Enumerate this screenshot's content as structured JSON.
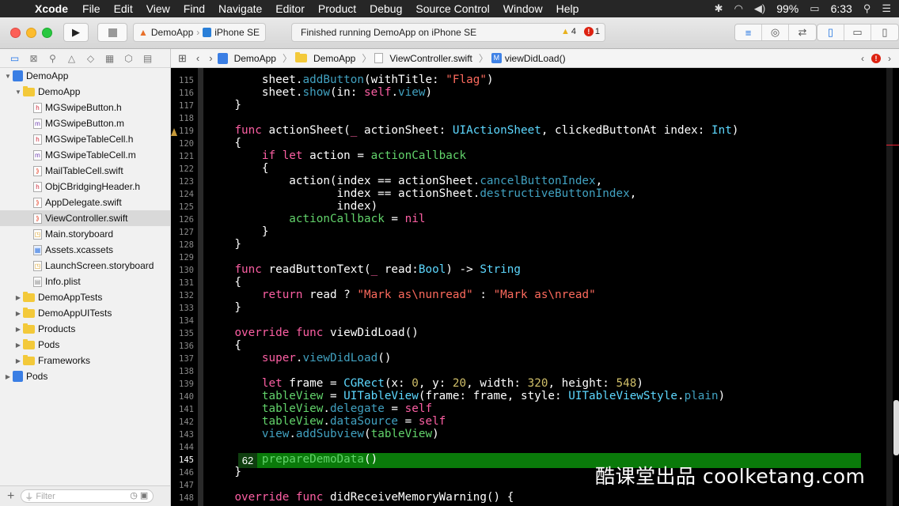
{
  "menubar": {
    "app": "Xcode",
    "items": [
      "File",
      "Edit",
      "View",
      "Find",
      "Navigate",
      "Editor",
      "Product",
      "Debug",
      "Source Control",
      "Window",
      "Help"
    ],
    "battery": "99%",
    "clock": "6:33"
  },
  "toolbar": {
    "scheme": "DemoApp",
    "destination": "iPhone SE",
    "activity": "Finished running DemoApp on iPhone SE",
    "warnings": "4",
    "errors": "1"
  },
  "navigator": {
    "filter_placeholder": "Filter",
    "items": [
      {
        "label": "DemoApp",
        "kind": "project",
        "depth": 0,
        "open": true
      },
      {
        "label": "DemoApp",
        "kind": "folder",
        "depth": 1,
        "open": true
      },
      {
        "label": "MGSwipeButton.h",
        "kind": "h",
        "depth": 2
      },
      {
        "label": "MGSwipeButton.m",
        "kind": "m",
        "depth": 2
      },
      {
        "label": "MGSwipeTableCell.h",
        "kind": "h",
        "depth": 2
      },
      {
        "label": "MGSwipeTableCell.m",
        "kind": "m",
        "depth": 2
      },
      {
        "label": "MailTableCell.swift",
        "kind": "swift",
        "depth": 2
      },
      {
        "label": "ObjCBridgingHeader.h",
        "kind": "h",
        "depth": 2
      },
      {
        "label": "AppDelegate.swift",
        "kind": "swift",
        "depth": 2
      },
      {
        "label": "ViewController.swift",
        "kind": "swift",
        "depth": 2,
        "selected": true
      },
      {
        "label": "Main.storyboard",
        "kind": "sb",
        "depth": 2
      },
      {
        "label": "Assets.xcassets",
        "kind": "assets",
        "depth": 2
      },
      {
        "label": "LaunchScreen.storyboard",
        "kind": "sb",
        "depth": 2
      },
      {
        "label": "Info.plist",
        "kind": "plist",
        "depth": 2
      },
      {
        "label": "DemoAppTests",
        "kind": "folder",
        "depth": 1,
        "open": false
      },
      {
        "label": "DemoAppUITests",
        "kind": "folder",
        "depth": 1,
        "open": false
      },
      {
        "label": "Products",
        "kind": "folder",
        "depth": 1,
        "open": false
      },
      {
        "label": "Pods",
        "kind": "folder",
        "depth": 1,
        "open": false
      },
      {
        "label": "Frameworks",
        "kind": "folder",
        "depth": 1,
        "open": false
      },
      {
        "label": "Pods",
        "kind": "project",
        "depth": 0,
        "open": false
      }
    ]
  },
  "jumpbar": {
    "crumbs": [
      "DemoApp",
      "DemoApp",
      "ViewController.swift",
      "viewDidLoad()"
    ]
  },
  "editor": {
    "current_line": 145,
    "exec_badge": "62",
    "first_line": 115,
    "line_numbers": [
      "115",
      "116",
      "117",
      "118",
      "119",
      "120",
      "121",
      "122",
      "123",
      "124",
      "125",
      "126",
      "127",
      "128",
      "129",
      "130",
      "131",
      "132",
      "133",
      "134",
      "135",
      "136",
      "137",
      "138",
      "139",
      "140",
      "141",
      "142",
      "143",
      "144",
      "145",
      "146",
      "147",
      "148"
    ],
    "lines": [
      [
        [
          "        sheet.",
          ""
        ],
        [
          "addButton",
          "fn"
        ],
        [
          "(withTitle: ",
          ""
        ],
        [
          "\"Flag\"",
          "st"
        ],
        [
          ")",
          ""
        ]
      ],
      [
        [
          "        sheet.",
          ""
        ],
        [
          "show",
          "fn"
        ],
        [
          "(in: ",
          ""
        ],
        [
          "self",
          "kw"
        ],
        [
          ".",
          ""
        ],
        [
          "view",
          "fn"
        ],
        [
          ")",
          ""
        ]
      ],
      [
        [
          "    }",
          ""
        ]
      ],
      [
        [
          "",
          ""
        ]
      ],
      [
        [
          "    ",
          ""
        ],
        [
          "func",
          "kw"
        ],
        [
          " actionSheet(",
          ""
        ],
        [
          "_",
          "kw"
        ],
        [
          " actionSheet: ",
          ""
        ],
        [
          "UIActionSheet",
          "ty"
        ],
        [
          ", clickedButtonAt index: ",
          ""
        ],
        [
          "Int",
          "ty"
        ],
        [
          ")",
          ""
        ]
      ],
      [
        [
          "    {",
          ""
        ]
      ],
      [
        [
          "        ",
          ""
        ],
        [
          "if let",
          "kw"
        ],
        [
          " action = ",
          ""
        ],
        [
          "actionCallback",
          "gn"
        ]
      ],
      [
        [
          "        {",
          ""
        ]
      ],
      [
        [
          "            action(index == actionSheet.",
          ""
        ],
        [
          "cancelButtonIndex",
          "fn"
        ],
        [
          ",",
          ""
        ]
      ],
      [
        [
          "                   index == actionSheet.",
          ""
        ],
        [
          "destructiveButtonIndex",
          "fn"
        ],
        [
          ",",
          ""
        ]
      ],
      [
        [
          "                   index)",
          ""
        ]
      ],
      [
        [
          "            ",
          ""
        ],
        [
          "actionCallback",
          "gn"
        ],
        [
          " = ",
          ""
        ],
        [
          "nil",
          "kw"
        ]
      ],
      [
        [
          "        }",
          ""
        ]
      ],
      [
        [
          "    }",
          ""
        ]
      ],
      [
        [
          "",
          ""
        ]
      ],
      [
        [
          "    ",
          ""
        ],
        [
          "func",
          "kw"
        ],
        [
          " readButtonText(",
          ""
        ],
        [
          "_",
          "kw"
        ],
        [
          " read:",
          ""
        ],
        [
          "Bool",
          "ty"
        ],
        [
          ") -> ",
          ""
        ],
        [
          "String",
          "ty"
        ]
      ],
      [
        [
          "    {",
          ""
        ]
      ],
      [
        [
          "        ",
          ""
        ],
        [
          "return",
          "kw"
        ],
        [
          " read ? ",
          ""
        ],
        [
          "\"Mark as\\nunread\"",
          "st"
        ],
        [
          " : ",
          ""
        ],
        [
          "\"Mark as\\nread\"",
          "st"
        ]
      ],
      [
        [
          "    }",
          ""
        ]
      ],
      [
        [
          "",
          ""
        ]
      ],
      [
        [
          "    ",
          ""
        ],
        [
          "override func",
          "kw"
        ],
        [
          " viewDidLoad()",
          ""
        ]
      ],
      [
        [
          "    {",
          ""
        ]
      ],
      [
        [
          "        ",
          ""
        ],
        [
          "super",
          "kw"
        ],
        [
          ".",
          ""
        ],
        [
          "viewDidLoad",
          "fn"
        ],
        [
          "()",
          ""
        ]
      ],
      [
        [
          "",
          ""
        ]
      ],
      [
        [
          "        ",
          ""
        ],
        [
          "let",
          "kw"
        ],
        [
          " frame = ",
          ""
        ],
        [
          "CGRect",
          "ty"
        ],
        [
          "(x: ",
          ""
        ],
        [
          "0",
          "num"
        ],
        [
          ", y: ",
          ""
        ],
        [
          "20",
          "num"
        ],
        [
          ", width: ",
          ""
        ],
        [
          "320",
          "num"
        ],
        [
          ", height: ",
          ""
        ],
        [
          "548",
          "num"
        ],
        [
          ")",
          ""
        ]
      ],
      [
        [
          "        ",
          ""
        ],
        [
          "tableView",
          "gn"
        ],
        [
          " = ",
          ""
        ],
        [
          "UITableView",
          "ty"
        ],
        [
          "(frame: frame, style: ",
          ""
        ],
        [
          "UITableViewStyle",
          "ty"
        ],
        [
          ".",
          ""
        ],
        [
          "plain",
          "fn"
        ],
        [
          ")",
          ""
        ]
      ],
      [
        [
          "        ",
          ""
        ],
        [
          "tableView",
          "gn"
        ],
        [
          ".",
          ""
        ],
        [
          "delegate",
          "fn"
        ],
        [
          " = ",
          ""
        ],
        [
          "self",
          "kw"
        ]
      ],
      [
        [
          "        ",
          ""
        ],
        [
          "tableView",
          "gn"
        ],
        [
          ".",
          ""
        ],
        [
          "dataSource",
          "fn"
        ],
        [
          " = ",
          ""
        ],
        [
          "self",
          "kw"
        ]
      ],
      [
        [
          "        ",
          ""
        ],
        [
          "view",
          "fn"
        ],
        [
          ".",
          ""
        ],
        [
          "addSubview",
          "fn"
        ],
        [
          "(",
          ""
        ],
        [
          "tableView",
          "gn"
        ],
        [
          ")",
          ""
        ]
      ],
      [
        [
          "",
          ""
        ]
      ],
      [
        [
          "        ",
          ""
        ],
        [
          "prepareDemoData",
          "gn"
        ],
        [
          "()",
          ""
        ]
      ],
      [
        [
          "    }",
          ""
        ]
      ],
      [
        [
          "",
          ""
        ]
      ],
      [
        [
          "    ",
          ""
        ],
        [
          "override func",
          "kw"
        ],
        [
          " didReceiveMemoryWarning() {",
          ""
        ]
      ]
    ]
  },
  "watermark": "酷课堂出品 coolketang.com"
}
